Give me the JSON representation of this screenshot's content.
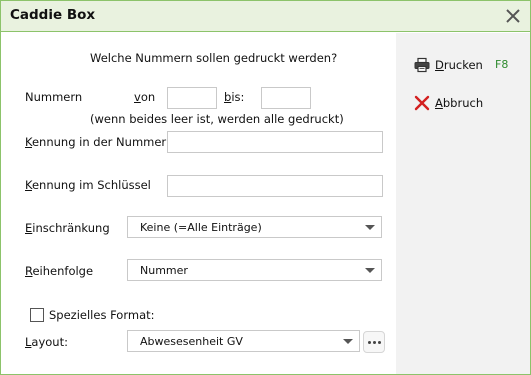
{
  "window": {
    "title": "Caddie Box"
  },
  "side": {
    "print_label": "Drucken",
    "print_key": "F8",
    "cancel_label": "Abbruch"
  },
  "form": {
    "heading": "Welche Nummern sollen gedruckt werden?",
    "numbers_label": "Nummern",
    "from_label": "von",
    "to_label": "bis:",
    "from_value": "",
    "to_value": "",
    "hint": "(wenn beides leer ist, werden alle gedruckt)",
    "id_in_number_label": "Kennung in der Nummer",
    "id_in_number_value": "",
    "id_in_key_label": "Kennung im Schlüssel",
    "id_in_key_value": "",
    "restriction_label": "Einschränkung",
    "restriction_value": "Keine (=Alle Einträge)",
    "order_label": "Reihenfolge",
    "order_value": "Nummer",
    "special_format_label": "Spezielles Format:",
    "special_format_checked": false,
    "layout_label": "Layout:",
    "layout_value": "Abwesesenheit GV"
  },
  "colors": {
    "titlebar_bg": "#e9f2df",
    "border": "#8cc36a",
    "side_bg": "#f2f2f2",
    "fkey": "#2e8b2e",
    "cancel_icon": "#d32020"
  }
}
